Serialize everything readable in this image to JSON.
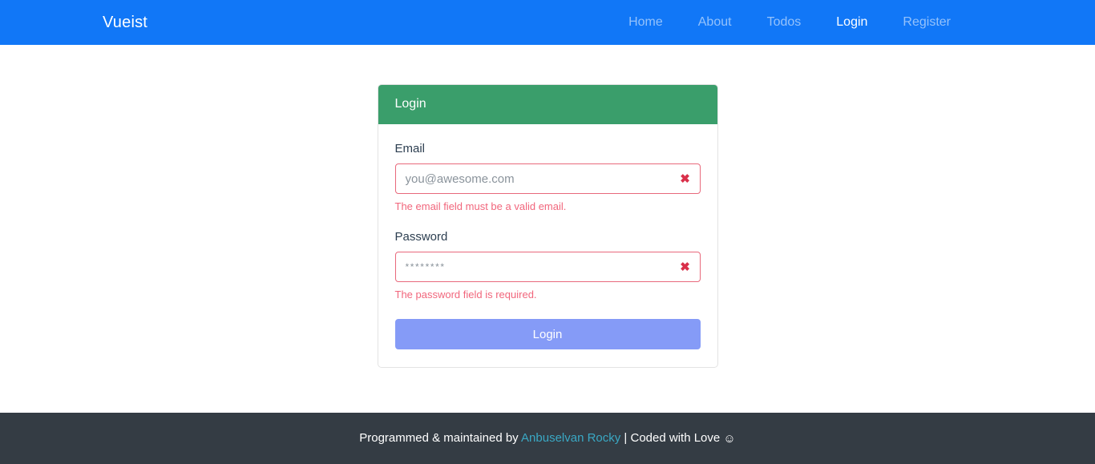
{
  "navbar": {
    "brand": "Vueist",
    "links": [
      {
        "label": "Home",
        "active": false
      },
      {
        "label": "About",
        "active": false
      },
      {
        "label": "Todos",
        "active": false
      },
      {
        "label": "Login",
        "active": true
      },
      {
        "label": "Register",
        "active": false
      }
    ],
    "background_color": "#1177f7",
    "active_link_color": "#ffffff",
    "inactive_link_color": "rgba(255,255,255,0.55)"
  },
  "login_card": {
    "header_title": "Login",
    "header_color": "#3a9e6b",
    "fields": [
      {
        "label": "Email",
        "placeholder": "you@awesome.com",
        "value": "",
        "icon": "cross-mark-icon",
        "icon_glyph": "✖",
        "error": "The email field must be a valid email.",
        "invalid": true
      },
      {
        "label": "Password",
        "placeholder": "********",
        "value": "",
        "icon": "cross-mark-icon",
        "icon_glyph": "✖",
        "error": "The password field is required.",
        "invalid": true
      }
    ],
    "submit_label": "Login",
    "submit_color": "#7b93f7",
    "error_color": "#f1667c",
    "invalid_border_color": "#e8697c"
  },
  "footer": {
    "prefix": "Programmed & maintained by ",
    "link_text": "Anbuselvan Rocky",
    "suffix": " | Coded with Love ",
    "smiley": "☺",
    "background_color": "#343c44",
    "link_color": "#3aa8c4"
  }
}
